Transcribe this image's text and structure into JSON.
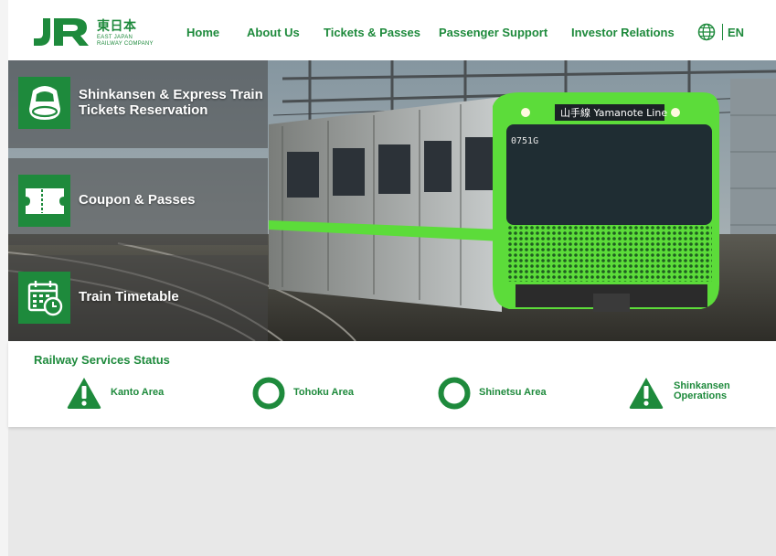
{
  "header": {
    "logo_jp": "東日本",
    "logo_en_line1": "EAST JAPAN",
    "logo_en_line2": "RAILWAY COMPANY",
    "nav": [
      "Home",
      "About Us",
      "Tickets & Passes",
      "Passenger Support",
      "Investor Relations"
    ],
    "language": "EN"
  },
  "hero": {
    "train_sign": "山手線 Yamanote Line",
    "train_number": "0751G",
    "menu": [
      {
        "label": "Shinkansen & Express Train Tickets Reservation",
        "icon": "shinkansen-icon"
      },
      {
        "label": "Coupon & Passes",
        "icon": "ticket-icon"
      },
      {
        "label": "Train Timetable",
        "icon": "calendar-clock-icon"
      }
    ]
  },
  "status": {
    "title": "Railway Services Status",
    "items": [
      {
        "label": "Kanto Area",
        "state": "warning"
      },
      {
        "label": "Tohoku Area",
        "state": "normal"
      },
      {
        "label": "Shinetsu Area",
        "state": "normal"
      },
      {
        "label": "Shinkansen Operations",
        "state": "warning"
      }
    ]
  },
  "colors": {
    "brand_green": "#1e8a3c",
    "train_green": "#5cdc3a"
  }
}
